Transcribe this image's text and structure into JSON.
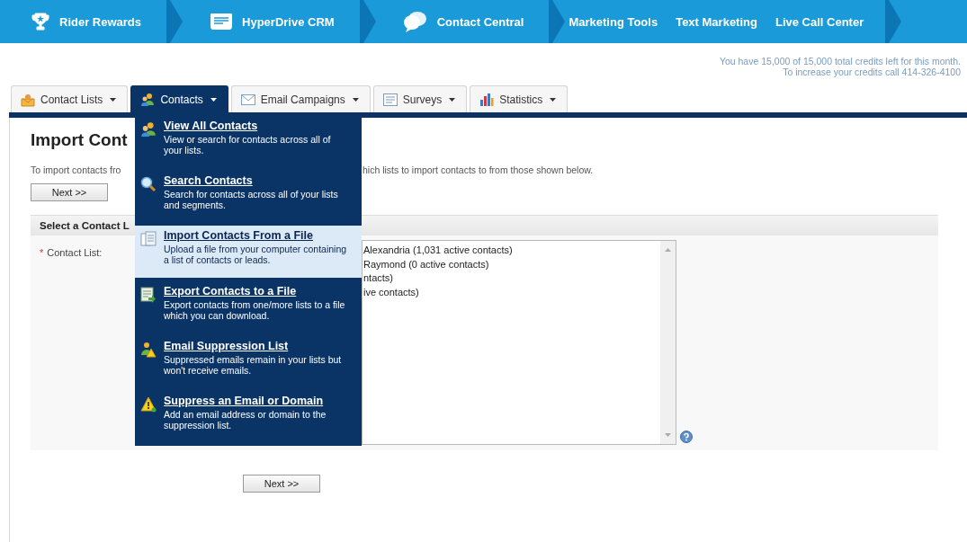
{
  "top_nav": {
    "items": [
      {
        "label": "Rider Rewards",
        "kind": "app"
      },
      {
        "label": "HyperDrive CRM",
        "kind": "app"
      },
      {
        "label": "Contact Central",
        "kind": "app"
      },
      {
        "label": "Marketing Tools",
        "kind": "link"
      },
      {
        "label": "Text Marketing",
        "kind": "link"
      },
      {
        "label": "Live Call Center",
        "kind": "link"
      }
    ]
  },
  "credits": [
    "You have 15,000 of 15,000 total credits left for this month.",
    "To increase your credits call 414-326-4100"
  ],
  "tabs": [
    {
      "label": "Contact Lists",
      "selected": false
    },
    {
      "label": "Contacts",
      "selected": true
    },
    {
      "label": "Email Campaigns",
      "selected": false
    },
    {
      "label": "Surveys",
      "selected": false
    },
    {
      "label": "Statistics",
      "selected": false
    }
  ],
  "page": {
    "title": "Import Cont",
    "description": [
      "To import contacts fro",
      "hich lists to import contacts to from those shown below."
    ],
    "next_button": "Next >>",
    "section": {
      "header": "Select a Contact L",
      "field_label": "Contact List:",
      "required_mark": "*",
      "options": [
        "Alexandria (1,031 active contacts)",
        "Raymond (0 active contacts)",
        "ntacts)",
        "ive contacts)"
      ]
    },
    "bottom_button": "Next >>"
  },
  "menu": {
    "items": [
      {
        "title": "View All Contacts",
        "description": "View or search for contacts across all of your lists.",
        "selected": false
      },
      {
        "title": "Search Contacts",
        "description": "Search for contacts across all of your lists and segments.",
        "selected": false
      },
      {
        "title": "Import Contacts From a File",
        "description": "Upload a file from your computer containing a list of contacts or leads.",
        "selected": true
      },
      {
        "title": "Export Contacts to a File",
        "description": "Export contacts from one/more lists to a file which you can download.",
        "selected": false
      },
      {
        "title": "Email Suppression List",
        "description": "Suppressed emails remain in your lists but won't receive emails.",
        "selected": false
      },
      {
        "title": "Suppress an Email or Domain",
        "description": "Add an email address or domain to the suppression list.",
        "selected": false
      }
    ]
  }
}
